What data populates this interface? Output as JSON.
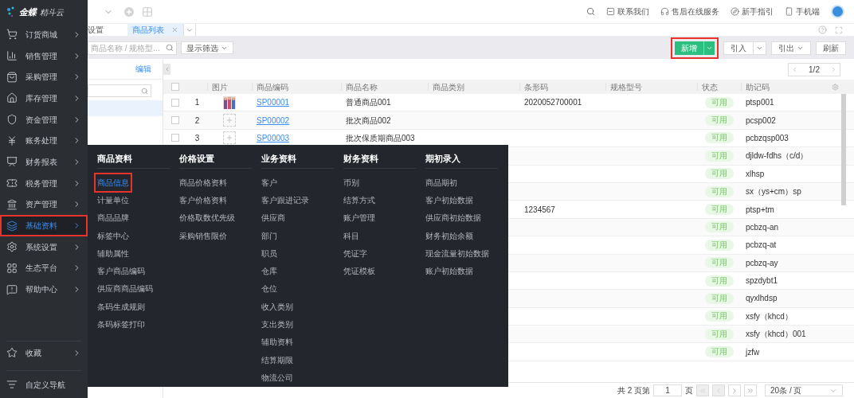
{
  "logo": {
    "brand": "金蝶",
    "product": "精斗云"
  },
  "sidebar": {
    "items": [
      {
        "label": "订货商城",
        "selected": false,
        "annotated": false
      },
      {
        "label": "销售管理",
        "selected": false,
        "annotated": false
      },
      {
        "label": "采购管理",
        "selected": false,
        "annotated": false
      },
      {
        "label": "库存管理",
        "selected": false,
        "annotated": false
      },
      {
        "label": "资金管理",
        "selected": false,
        "annotated": false
      },
      {
        "label": "账务处理",
        "selected": false,
        "annotated": false
      },
      {
        "label": "财务报表",
        "selected": false,
        "annotated": false
      },
      {
        "label": "税务管理",
        "selected": false,
        "annotated": false
      },
      {
        "label": "资产管理",
        "selected": false,
        "annotated": false
      },
      {
        "label": "基础资料",
        "selected": true,
        "annotated": true
      },
      {
        "label": "系统设置",
        "selected": false,
        "annotated": false
      },
      {
        "label": "生态平台",
        "selected": false,
        "annotated": false
      },
      {
        "label": "帮助中心",
        "selected": false,
        "annotated": false
      }
    ],
    "favorites": "收藏",
    "custom_nav": "自定义导航"
  },
  "top_bar": {
    "links": [
      "联系我们",
      "售后在线服务",
      "新手指引",
      "手机端"
    ]
  },
  "tabs": [
    {
      "label": "设置",
      "selected": false
    },
    {
      "label": "商品列表",
      "selected": true
    }
  ],
  "toolbar": {
    "search": {
      "placeholder": "商品名称 / 规格型..."
    },
    "filter_button": "显示筛选",
    "buttons": [
      {
        "label": "新增",
        "kind": "primary",
        "annotated": true
      },
      {
        "label": "引入",
        "kind": "split",
        "annotated": false
      },
      {
        "label": "引出",
        "kind": "dropdown",
        "annotated": false
      },
      {
        "label": "刷新",
        "kind": "plain",
        "annotated": false
      }
    ]
  },
  "category_panel": {
    "edit_link": "编辑"
  },
  "pager_top": {
    "page": "1/2"
  },
  "table": {
    "columns": [
      "图片",
      "商品编码",
      "商品名称",
      "商品类别",
      "条形码",
      "规格型号",
      "状态",
      "助记码"
    ],
    "header_checked": false,
    "rows": [
      {
        "checked": false,
        "index": "1",
        "kind": "picture",
        "code": "SP00001",
        "name": "普通商品001",
        "barcode": "2020052700001",
        "status": "可用",
        "mnemonic": "ptsp001"
      },
      {
        "checked": false,
        "index": "2",
        "kind": "no_image",
        "code": "SP00002",
        "name": "批次商品002",
        "status": "可用",
        "mnemonic": "pcsp002"
      },
      {
        "checked": false,
        "index": "3",
        "kind": "no_image",
        "code": "SP00003",
        "name": "批次保质期商品003",
        "status": "可用",
        "mnemonic": "pcbzqsp003"
      },
      {
        "status": "可用",
        "mnemonic": "djldw-fdhs（c/d）"
      },
      {
        "status": "可用",
        "mnemonic": "xlhsp"
      },
      {
        "status": "可用",
        "mnemonic": "sx（ys+cm）sp"
      },
      {
        "barcode": "1234567",
        "status": "可用",
        "mnemonic": "ptsp+tm"
      },
      {
        "status": "可用",
        "mnemonic": "pcbzq-an"
      },
      {
        "status": "可用",
        "mnemonic": "pcbzq-at"
      },
      {
        "status": "可用",
        "mnemonic": "pcbzq-ay"
      },
      {
        "status": "可用",
        "mnemonic": "spzdybt1"
      },
      {
        "status": "可用",
        "mnemonic": "qyxlhdsp"
      },
      {
        "status": "可用",
        "mnemonic": "xsfy（khcd）"
      },
      {
        "status": "可用",
        "mnemonic": "xsfy（khcd）001"
      },
      {
        "status": "可用",
        "mnemonic": "jzfw"
      }
    ]
  },
  "footer": {
    "prefix": "共 2 页第",
    "page_input": "1",
    "suffix": "页",
    "page_size": "20条 / 页"
  },
  "mega_menu": {
    "columns": [
      {
        "title": "商品资料",
        "items": [
          {
            "label": "商品信息",
            "selected": true,
            "annotated": true
          },
          {
            "label": "计量单位",
            "selected": false,
            "annotated": false
          },
          {
            "label": "商品品牌",
            "selected": false,
            "annotated": false
          },
          {
            "label": "标签中心",
            "selected": false,
            "annotated": false
          },
          {
            "label": "辅助属性",
            "selected": false,
            "annotated": false
          },
          {
            "label": "客户商品编码",
            "selected": false,
            "annotated": false
          },
          {
            "label": "供应商商品编码",
            "selected": false,
            "annotated": false
          },
          {
            "label": "条码生成规则",
            "selected": false,
            "annotated": false
          },
          {
            "label": "条码标签打印",
            "selected": false,
            "annotated": false
          }
        ]
      },
      {
        "title": "价格设置",
        "items": [
          {
            "label": "商品价格资料",
            "selected": false,
            "annotated": false
          },
          {
            "label": "客户价格资料",
            "selected": false,
            "annotated": false
          },
          {
            "label": "价格取数优先级",
            "selected": false,
            "annotated": false
          },
          {
            "label": "采购销售限价",
            "selected": false,
            "annotated": false
          }
        ]
      },
      {
        "title": "业务资料",
        "items": [
          {
            "label": "客户",
            "selected": false,
            "annotated": false
          },
          {
            "label": "客户跟进记录",
            "selected": false,
            "annotated": false
          },
          {
            "label": "供应商",
            "selected": false,
            "annotated": false
          },
          {
            "label": "部门",
            "selected": false,
            "annotated": false
          },
          {
            "label": "职员",
            "selected": false,
            "annotated": false
          },
          {
            "label": "仓库",
            "selected": false,
            "annotated": false
          },
          {
            "label": "仓位",
            "selected": false,
            "annotated": false
          },
          {
            "label": "收入类别",
            "selected": false,
            "annotated": false
          },
          {
            "label": "支出类别",
            "selected": false,
            "annotated": false
          },
          {
            "label": "辅助资料",
            "selected": false,
            "annotated": false
          },
          {
            "label": "结算期限",
            "selected": false,
            "annotated": false
          },
          {
            "label": "物流公司",
            "selected": false,
            "annotated": false
          }
        ]
      },
      {
        "title": "财务资料",
        "items": [
          {
            "label": "币别",
            "selected": false,
            "annotated": false
          },
          {
            "label": "结算方式",
            "selected": false,
            "annotated": false
          },
          {
            "label": "账户管理",
            "selected": false,
            "annotated": false
          },
          {
            "label": "科目",
            "selected": false,
            "annotated": false
          },
          {
            "label": "凭证字",
            "selected": false,
            "annotated": false
          },
          {
            "label": "凭证模板",
            "selected": false,
            "annotated": false
          }
        ]
      },
      {
        "title": "期初录入",
        "items": [
          {
            "label": "商品期初",
            "selected": false,
            "annotated": false
          },
          {
            "label": "客户初始数据",
            "selected": false,
            "annotated": false
          },
          {
            "label": "供应商初始数据",
            "selected": false,
            "annotated": false
          },
          {
            "label": "财务初始余额",
            "selected": false,
            "annotated": false
          },
          {
            "label": "现金流量初始数据",
            "selected": false,
            "annotated": false
          },
          {
            "label": "账户初始数据",
            "selected": false,
            "annotated": false
          }
        ]
      }
    ]
  }
}
